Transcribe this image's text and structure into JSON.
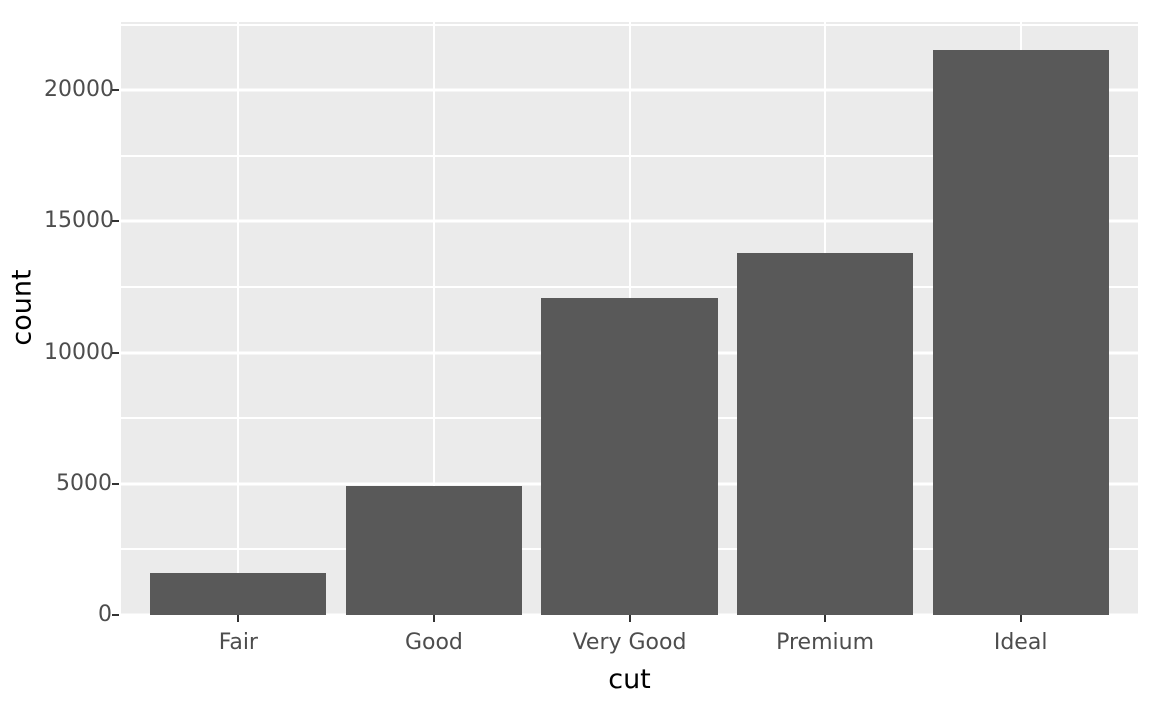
{
  "chart_data": {
    "type": "bar",
    "title": "",
    "subtitle": "",
    "xlabel": "cut",
    "ylabel": "count",
    "categories": [
      "Fair",
      "Good",
      "Very Good",
      "Premium",
      "Ideal"
    ],
    "values": [
      1610,
      4906,
      12082,
      13791,
      21551
    ],
    "series": [
      {
        "name": "count",
        "values": [
          1610,
          4906,
          12082,
          13791,
          21551
        ]
      }
    ],
    "ylim": [
      0,
      22600
    ],
    "xlim": [
      0.4,
      5.6
    ],
    "y_ticks": [
      0,
      5000,
      10000,
      15000,
      20000
    ],
    "y_tick_labels": [
      "0",
      "5000",
      "10000",
      "15000",
      "20000"
    ],
    "y_minor_ticks": [
      2500,
      7500,
      12500,
      17500,
      22500
    ],
    "x_tick_labels": [
      "Fair",
      "Good",
      "Very Good",
      "Premium",
      "Ideal"
    ],
    "grid": "major-and-minor-horizontal, minor-vertical",
    "legend": "none",
    "annotations": [],
    "bar_color": "#595959",
    "panel_background": "#EBEBEB",
    "grid_color": "#FFFFFF",
    "axis_text_color": "#4D4D4D",
    "axis_title_color": "#000000",
    "plot_background": "#FFFFFF",
    "bar_width_fraction": 0.9
  }
}
